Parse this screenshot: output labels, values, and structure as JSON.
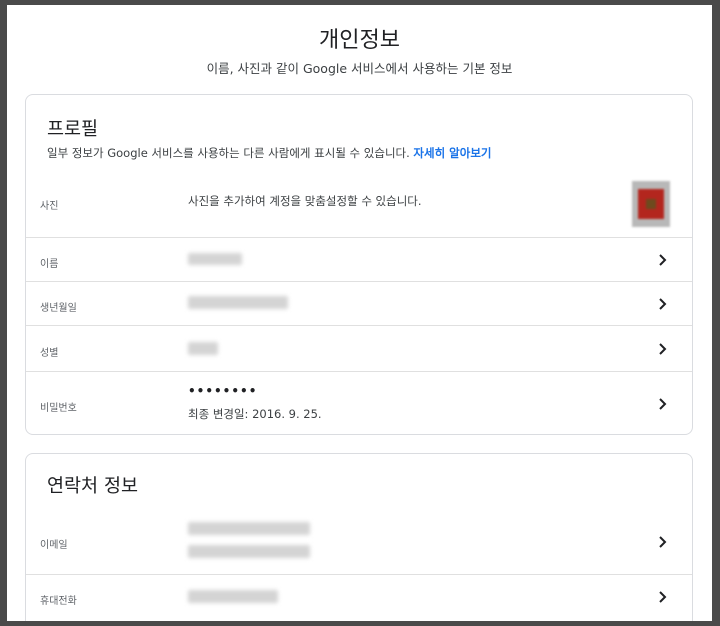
{
  "page": {
    "title": "개인정보",
    "subtitle": "이름, 사진과 같이 Google 서비스에서 사용하는 기본 정보"
  },
  "profile": {
    "title": "프로필",
    "description": "일부 정보가 Google 서비스를 사용하는 다른 사람에게 표시될 수 있습니다.",
    "learn_more": "자세히 알아보기",
    "rows": {
      "photo": {
        "label": "사진",
        "value": "사진을 추가하여 계정을 맞춤설정할 수 있습니다."
      },
      "name": {
        "label": "이름"
      },
      "birthday": {
        "label": "생년월일"
      },
      "gender": {
        "label": "성별"
      },
      "password": {
        "label": "비밀번호",
        "value": "••••••••",
        "sub": "최종 변경일: 2016. 9. 25."
      }
    }
  },
  "contact": {
    "title": "연락처 정보",
    "rows": {
      "email": {
        "label": "이메일"
      },
      "phone": {
        "label": "휴대전화"
      }
    }
  },
  "icons": {
    "chevron": "chevron-right-icon",
    "avatar": "avatar"
  },
  "colors": {
    "link": "#1a73e8",
    "divider": "#e0e0e0",
    "card_border": "#dadce0"
  }
}
